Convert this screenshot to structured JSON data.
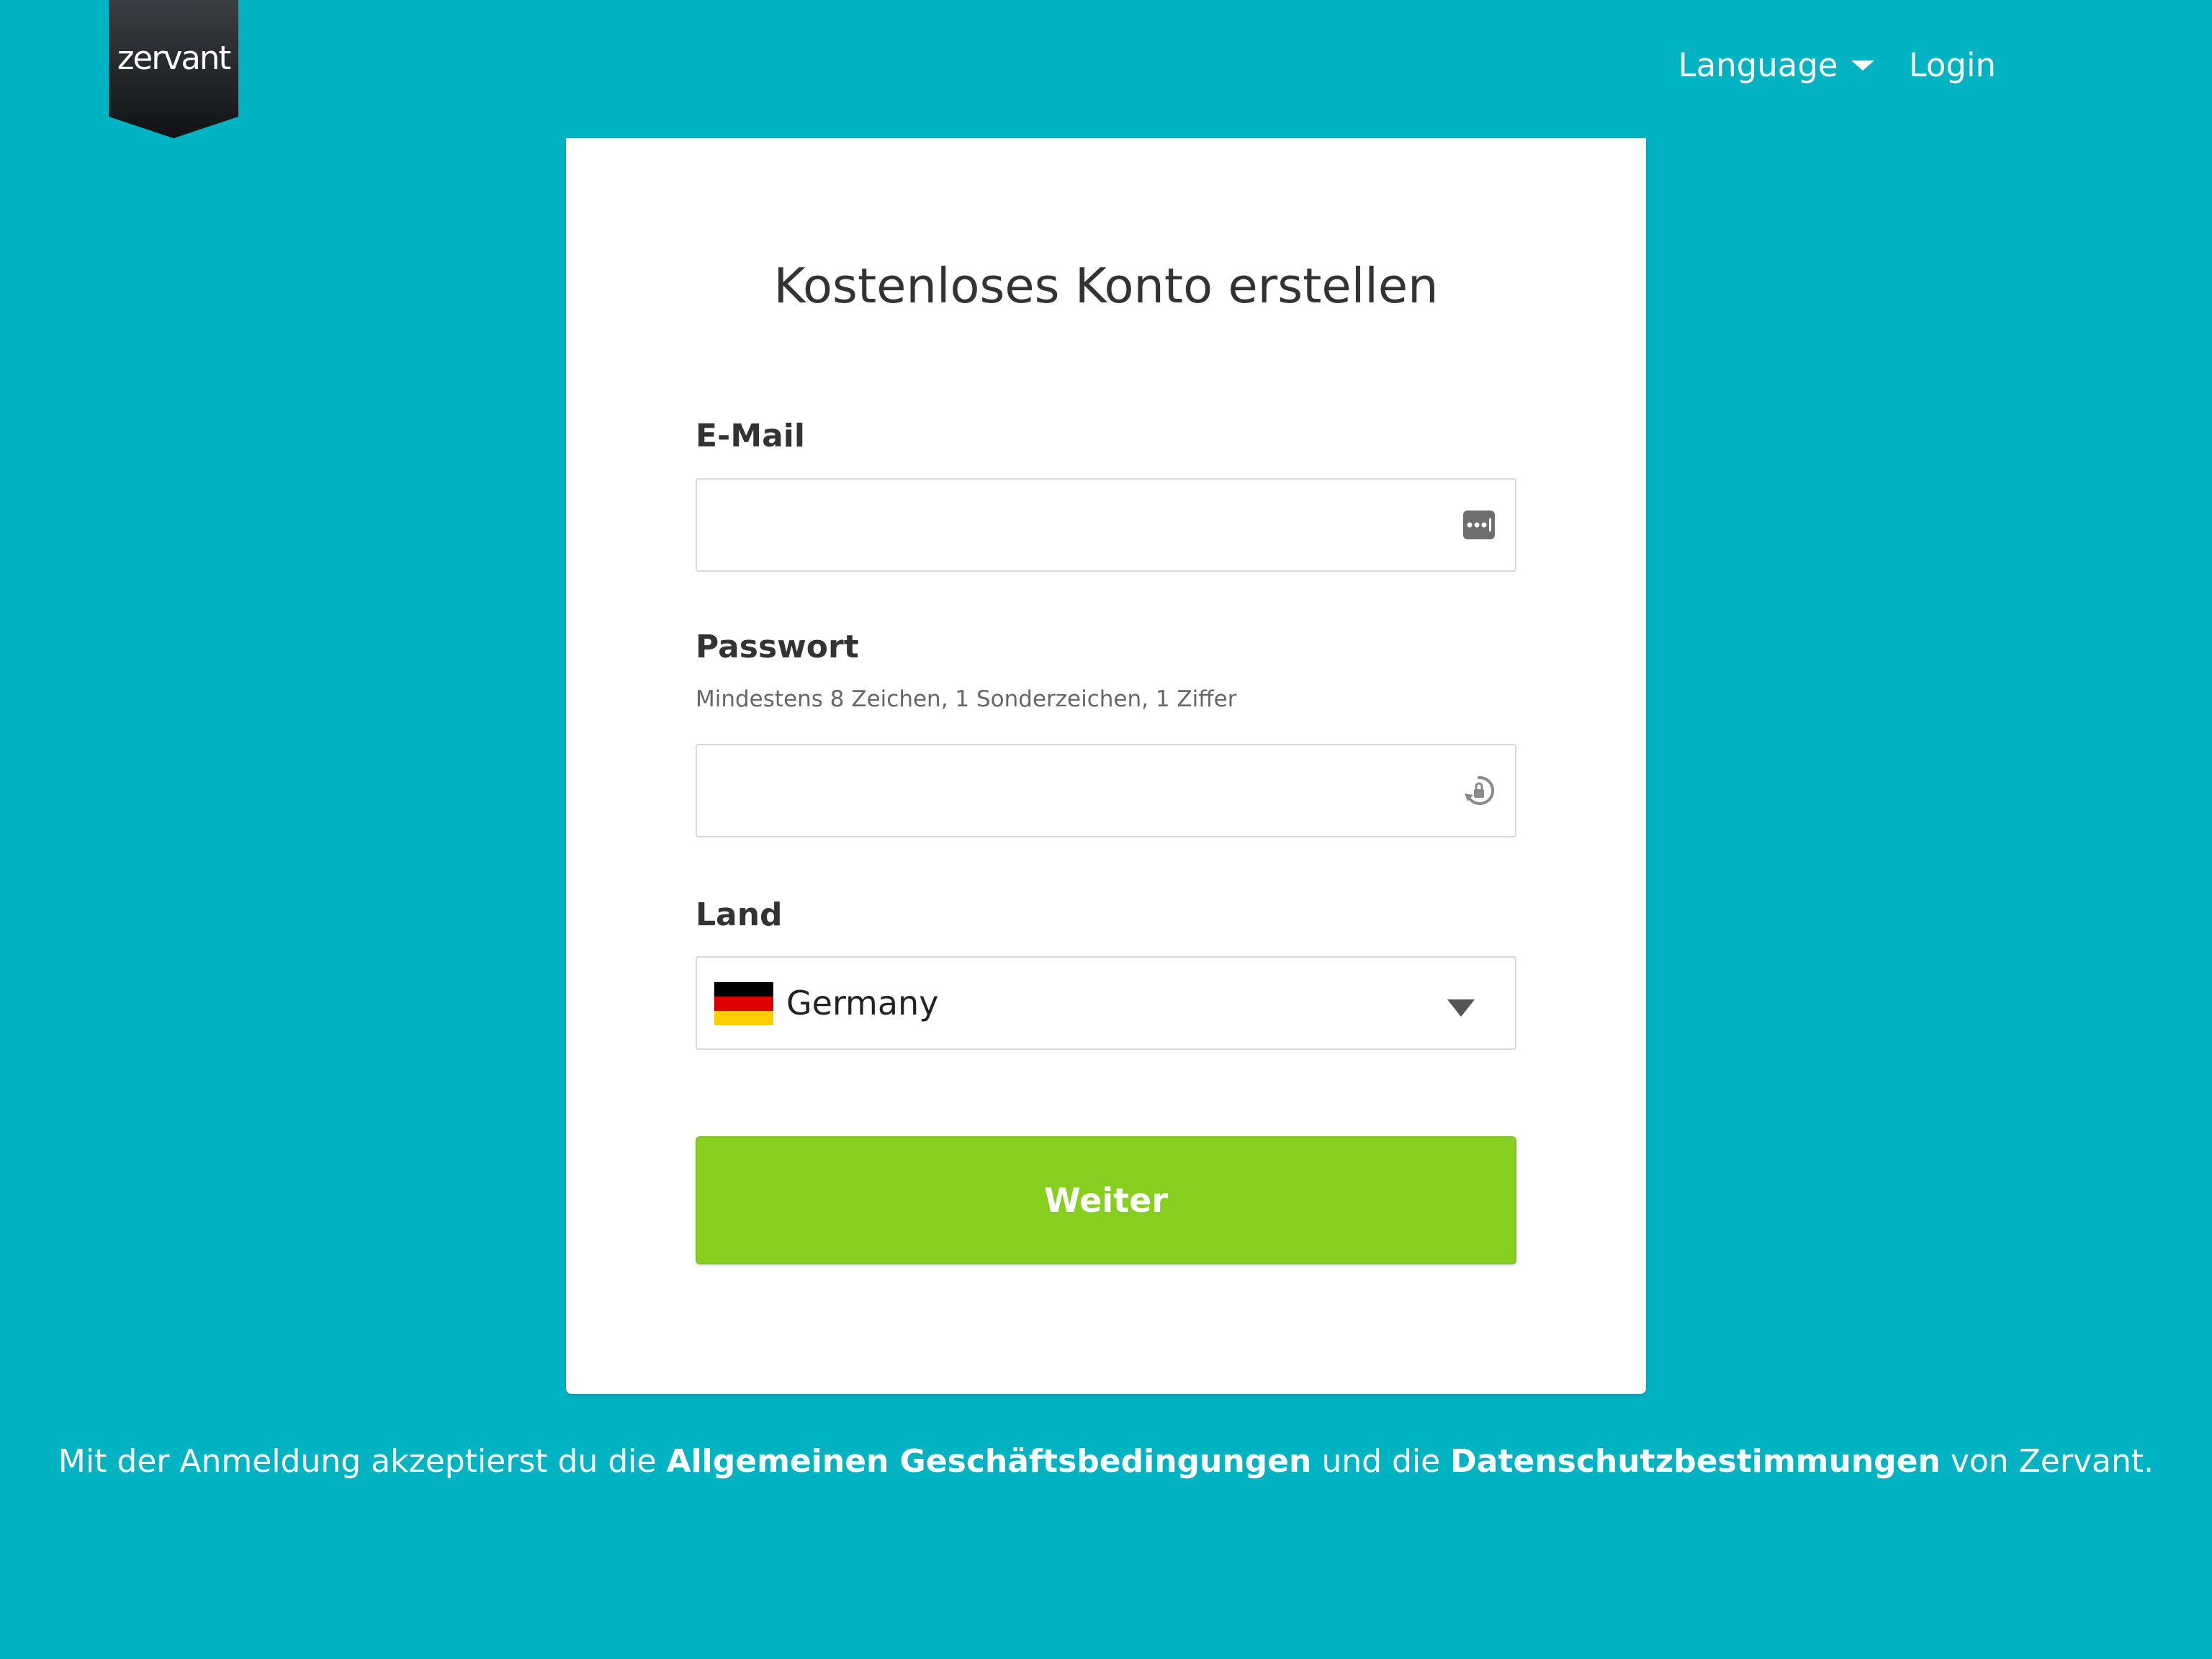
{
  "header": {
    "logo_text": "zervant",
    "nav": {
      "language_label": "Language",
      "login_label": "Login"
    }
  },
  "form": {
    "title": "Kostenloses Konto erstellen",
    "email": {
      "label": "E-Mail",
      "value": "",
      "placeholder": "",
      "icon": "password-manager-icon"
    },
    "password": {
      "label": "Passwort",
      "hint": "Mindestens 8 Zeichen, 1 Sonderzeichen, 1 Ziffer",
      "value": "",
      "placeholder": "",
      "icon": "password-generator-icon"
    },
    "country": {
      "label": "Land",
      "selected": "Germany",
      "flag_colors": [
        "#000000",
        "#dd0000",
        "#ffce00"
      ]
    },
    "submit_label": "Weiter"
  },
  "footer": {
    "text_before": "Mit der Anmeldung akzeptierst du die ",
    "terms_link": "Allgemeinen Geschäftsbedingungen",
    "text_middle": " und die ",
    "privacy_link": "Datenschutzbestimmungen",
    "text_after": " von Zervant."
  },
  "colors": {
    "background": "#00b3c2",
    "button": "#86cf1f",
    "logo": "#1c1f22"
  }
}
